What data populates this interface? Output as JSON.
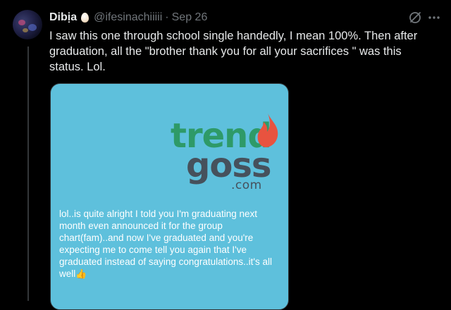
{
  "tweet": {
    "display_name": "Dibịa",
    "emoji_badge": "egg-emoji",
    "handle": "@ifesinachiiiii",
    "separator": "·",
    "date": "Sep 26",
    "text": "I saw this one through school single handedly, I mean 100%. Then after graduation, all the \"brother thank you for all your sacrifices \" was this status. Lol."
  },
  "media": {
    "background_color": "#5ec0dc",
    "logo": {
      "word1": "trend",
      "word2": "goss",
      "word3": ".com",
      "green": "#2e9a68",
      "gray": "#46515c",
      "flame": "#e8533f"
    },
    "status_text": "lol..is quite alright I told you I'm graduating next month even announced it for the group chart(fam)..and now I've graduated and you're expecting me to come tell you again that I've graduated instead of saying congratulations..it's all well",
    "status_emoji": "👍"
  },
  "icons": {
    "grok": "grok-icon",
    "more": "more-icon"
  }
}
